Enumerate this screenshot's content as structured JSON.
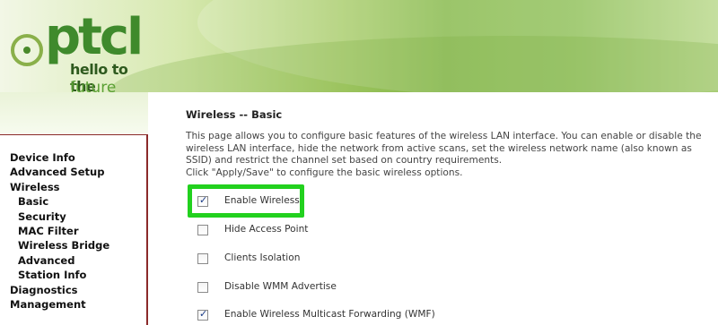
{
  "header": {
    "logo_text": "ptcl",
    "tagline_line1": "hello to the",
    "tagline_line2": "future"
  },
  "sidebar": {
    "items": [
      {
        "label": "Device Info",
        "level": 0
      },
      {
        "label": "Advanced Setup",
        "level": 0
      },
      {
        "label": "Wireless",
        "level": 0
      },
      {
        "label": "Basic",
        "level": 1
      },
      {
        "label": "Security",
        "level": 1
      },
      {
        "label": "MAC Filter",
        "level": 1
      },
      {
        "label": "Wireless Bridge",
        "level": 1
      },
      {
        "label": "Advanced",
        "level": 1
      },
      {
        "label": "Station Info",
        "level": 1
      },
      {
        "label": "Diagnostics",
        "level": 0
      },
      {
        "label": "Management",
        "level": 0
      }
    ]
  },
  "main": {
    "title": "Wireless -- Basic",
    "description_line1": "This page allows you to configure basic features of the wireless LAN interface. You can enable or disable the wireless LAN interface, hide the network from active scans, set the wireless network name (also known as SSID) and restrict the channel set based on country requirements.",
    "description_line2": "Click \"Apply/Save\" to configure the basic wireless options.",
    "options": [
      {
        "label": "Enable Wireless",
        "checked": true,
        "highlighted": true
      },
      {
        "label": "Hide Access Point",
        "checked": false
      },
      {
        "label": "Clients Isolation",
        "checked": false
      },
      {
        "label": "Disable WMM Advertise",
        "checked": false
      },
      {
        "label": "Enable Wireless Multicast Forwarding (WMF)",
        "checked": true
      }
    ]
  },
  "colors": {
    "highlight": "#22d11e",
    "sidebar_border": "#8b2a2a",
    "brand_green": "#3f8a2c"
  }
}
